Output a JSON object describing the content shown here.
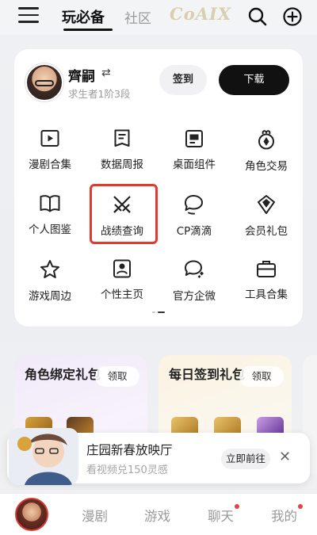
{
  "header": {
    "tab_active": "玩必备",
    "tab_community": "社区",
    "logo_text": "CoAIX"
  },
  "profile": {
    "name": "齊嗣",
    "switch_glyph": "⇄",
    "level": "求生者1阶3段",
    "checkin_label": "签到",
    "download_label": "下载"
  },
  "tools": [
    {
      "label": "漫剧合集",
      "icon": "play-icon"
    },
    {
      "label": "数据周报",
      "icon": "report-icon"
    },
    {
      "label": "桌面组件",
      "icon": "widget-icon"
    },
    {
      "label": "角色交易",
      "icon": "trade-bag-icon"
    },
    {
      "label": "个人图鉴",
      "icon": "book-icon"
    },
    {
      "label": "战绩查询",
      "icon": "crossed-swords-icon"
    },
    {
      "label": "CP滴滴",
      "icon": "chat-bubbles-icon"
    },
    {
      "label": "会员礼包",
      "icon": "gift-icon"
    },
    {
      "label": "游戏周边",
      "icon": "star-icon"
    },
    {
      "label": "个性主页",
      "icon": "portrait-icon"
    },
    {
      "label": "官方企微",
      "icon": "wechat-work-icon"
    },
    {
      "label": "工具合集",
      "icon": "toolbox-icon"
    }
  ],
  "promos": [
    {
      "title": "角色绑定礼包",
      "claim": "领取"
    },
    {
      "title": "每日签到礼包",
      "claim": "领取"
    }
  ],
  "banner": {
    "title": "庄园新春放映厅",
    "subtitle": "看视频兑150灵感",
    "action": "立即前往",
    "close_glyph": "✕"
  },
  "bottom_nav": {
    "items": [
      "漫剧",
      "游戏",
      "聊天",
      "我的"
    ]
  },
  "colors": {
    "accent_red": "#e23a2d",
    "button_dark": "#111111"
  }
}
